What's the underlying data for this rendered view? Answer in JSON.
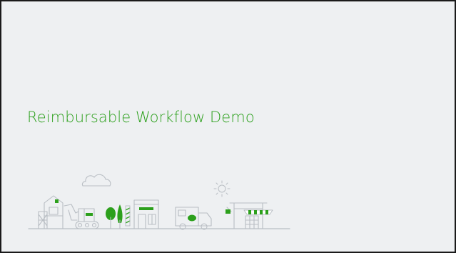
{
  "slide": {
    "title": "Reimbursable Workflow Demo"
  },
  "colors": {
    "title": "#2ca01c",
    "accent_green": "#2ca01c",
    "line_art": "#b9bec4",
    "background": "#eef0f2",
    "frame": "#1a1a1a"
  },
  "illustration": {
    "icons": [
      "barn-icon",
      "tractor-icon",
      "tree-icon",
      "storefront-icon",
      "truck-icon",
      "sun-icon",
      "cloud-icon",
      "market-stall-icon"
    ]
  }
}
